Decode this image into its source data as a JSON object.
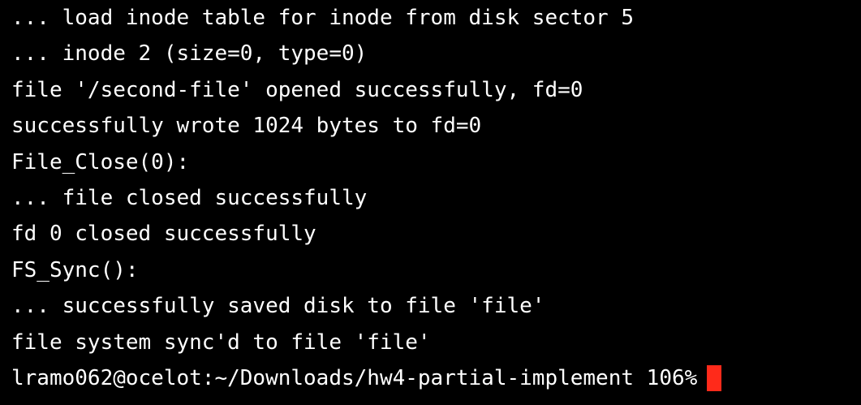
{
  "terminal": {
    "lines": [
      "... load inode table for inode from disk sector 5",
      "... inode 2 (size=0, type=0)",
      "file '/second-file' opened successfully, fd=0",
      "successfully wrote 1024 bytes to fd=0",
      "File_Close(0):",
      "... file closed successfully",
      "fd 0 closed successfully",
      "FS_Sync():",
      "... successfully saved disk to file 'file'",
      "file system sync'd to file 'file'"
    ],
    "prompt": "lramo062@ocelot:~/Downloads/hw4-partial-implement 106%",
    "cursor_color": "#ff2a1a",
    "background_color": "#000000",
    "text_color": "#ffffff"
  }
}
